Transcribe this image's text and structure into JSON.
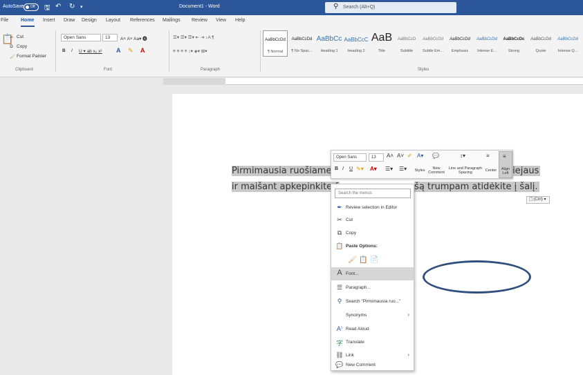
{
  "titlebar": {
    "autosave_label": "AutoSave",
    "autosave_state": "Off",
    "document_title": "Document1 - Word",
    "search_placeholder": "Search (Alt+Q)"
  },
  "menu_tabs": [
    "File",
    "Home",
    "Insert",
    "Draw",
    "Design",
    "Layout",
    "References",
    "Mailings",
    "Review",
    "View",
    "Help"
  ],
  "active_tab": "Home",
  "ribbon": {
    "clipboard": {
      "cut": "Cut",
      "copy": "Copy",
      "format_painter": "Format Painter",
      "paste": "Paste",
      "group_label": "Clipboard"
    },
    "font": {
      "font_name": "Open Sans",
      "font_size": "13",
      "group_label": "Font"
    },
    "paragraph": {
      "group_label": "Paragraph"
    },
    "styles": {
      "group_label": "Styles",
      "items": [
        {
          "preview": "AaBbCcDd",
          "name": "¶ Normal"
        },
        {
          "preview": "AaBbCcDd",
          "name": "¶ No Spac..."
        },
        {
          "preview": "AaBbCc",
          "name": "Heading 1"
        },
        {
          "preview": "AaBbCcC",
          "name": "Heading 2"
        },
        {
          "preview": "AaB",
          "name": "Title"
        },
        {
          "preview": "AaBbCcD",
          "name": "Subtitle"
        },
        {
          "preview": "AaBbCcDd",
          "name": "Subtle Em..."
        },
        {
          "preview": "AaBbCcDd",
          "name": "Emphasis"
        },
        {
          "preview": "AaBbCcDd",
          "name": "Intense E..."
        },
        {
          "preview": "AaBbCcDc",
          "name": "Strong"
        },
        {
          "preview": "AaBbCcDd",
          "name": "Quote"
        },
        {
          "preview": "AaBbCcDd",
          "name": "Intense Q..."
        }
      ]
    }
  },
  "document": {
    "line1_start": "Pirmimausia ruošiame",
    "line1_end": "puputį aliejaus",
    "line2_start": "ir maišant apkepinkite f",
    "line2_end": "šą trumpam atidėkite į šalį.",
    "paste_control": "(Ctrl)"
  },
  "mini_toolbar": {
    "font_name": "Open Sans",
    "font_size": "13",
    "styles": "Styles",
    "new_comment": "New Comment",
    "line_spacing": "Line and Paragraph Spacing",
    "center": "Center",
    "align_left": "Align Left"
  },
  "context_menu": {
    "search_placeholder": "Search the menus",
    "items": [
      {
        "icon": "editor-icon",
        "label": "Review selection in Editor"
      },
      {
        "icon": "cut-icon",
        "label": "Cut"
      },
      {
        "icon": "copy-icon",
        "label": "Copy"
      },
      {
        "icon": "paste-icon",
        "label": "Paste Options:"
      },
      {
        "icon": "font-icon",
        "label": "Font..."
      },
      {
        "icon": "paragraph-icon",
        "label": "Paragraph..."
      },
      {
        "icon": "search-icon",
        "label": "Search \"Pirmimausia ruo...\""
      },
      {
        "icon": "",
        "label": "Synonyms"
      },
      {
        "icon": "read-aloud-icon",
        "label": "Read Aloud"
      },
      {
        "icon": "translate-icon",
        "label": "Translate"
      },
      {
        "icon": "link-icon",
        "label": "Link"
      },
      {
        "icon": "comment-icon",
        "label": "New Comment"
      }
    ]
  },
  "colors": {
    "title_bar": "#2b579a",
    "annotation_ellipse": "#2f4f7f",
    "selection": "#c8c8c8"
  }
}
